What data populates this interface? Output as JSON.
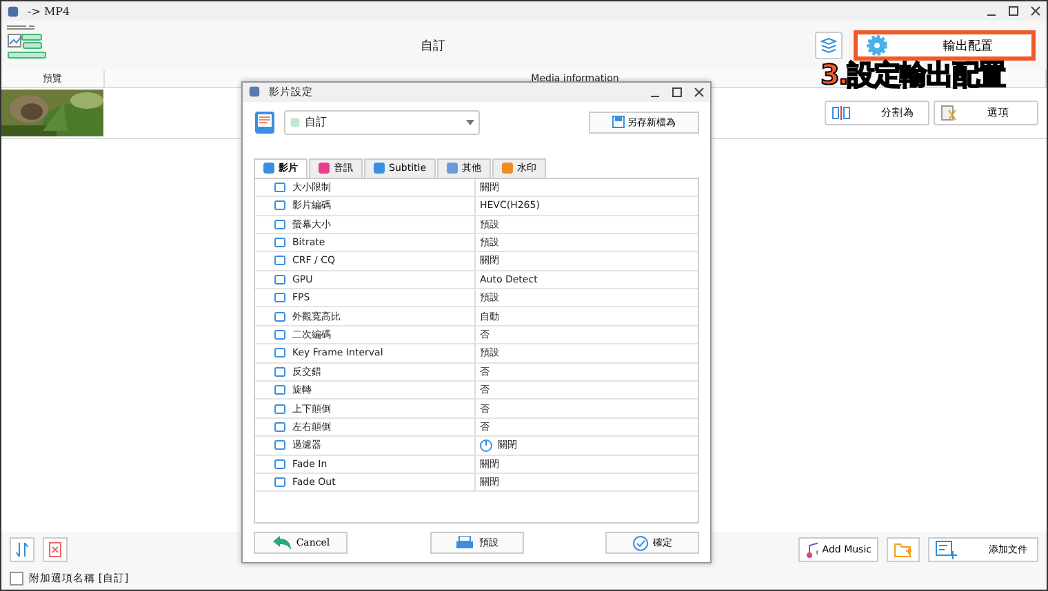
{
  "window": {
    "title": "-> MP4"
  },
  "toolbar": {
    "profile": "自訂",
    "output_button": "輸出配置",
    "annotation": "3.設定輸出配置"
  },
  "table": {
    "columns": [
      "預覽",
      "Media information"
    ],
    "rows": [
      {
        "kind": "picture",
        "split_button": "分割為",
        "options_button": "選項"
      }
    ]
  },
  "bottom": {
    "add_music": "Add Music",
    "add_file": "添加文件",
    "append_name": {
      "label": "附加選項名稱 [自訂]",
      "checked": false
    }
  },
  "dialog": {
    "title": "影片設定",
    "preset": "自訂",
    "save_as": "另存新檔為",
    "tabs": [
      {
        "label": "影片",
        "selected": true,
        "color": "#3b8fe0"
      },
      {
        "label": "音訊",
        "selected": false,
        "color": "#e83e8c"
      },
      {
        "label": "Subtitle",
        "selected": false,
        "color": "#3b8fe0"
      },
      {
        "label": "其他",
        "selected": false,
        "color": "#6a9bd8"
      },
      {
        "label": "水印",
        "selected": false,
        "color": "#f08a24"
      }
    ],
    "rows": [
      {
        "label": "大小限制",
        "value": "關閉",
        "kind": "plain"
      },
      {
        "label": "影片編碼",
        "value": "HEVC(H265)",
        "kind": "plain"
      },
      {
        "label": "螢幕大小",
        "value": "預設",
        "kind": "plain"
      },
      {
        "label": "Bitrate",
        "value": "預設",
        "kind": "plain"
      },
      {
        "label": "CRF / CQ",
        "value": "關閉",
        "kind": "plain"
      },
      {
        "label": "GPU",
        "value": "Auto Detect",
        "kind": "plain"
      },
      {
        "label": "FPS",
        "value": "預設",
        "kind": "plain"
      },
      {
        "label": "外觀寬高比",
        "value": "自動",
        "kind": "plain"
      },
      {
        "label": "二次編碼",
        "value": "否",
        "kind": "plain"
      },
      {
        "label": "Key Frame Interval",
        "value": "預設",
        "kind": "plain"
      },
      {
        "label": "反交錯",
        "value": "否",
        "kind": "plain"
      },
      {
        "label": "旋轉",
        "value": "否",
        "kind": "plain"
      },
      {
        "label": "上下顛倒",
        "value": "否",
        "kind": "plain"
      },
      {
        "label": "左右顛倒",
        "value": "否",
        "kind": "plain"
      },
      {
        "label": "過濾器",
        "value": "關閉",
        "kind": "switch"
      },
      {
        "label": "Fade In",
        "value": "關閉",
        "kind": "plain"
      },
      {
        "label": "Fade Out",
        "value": "關閉",
        "kind": "plain"
      }
    ],
    "buttons": {
      "cancel": "Cancel",
      "default": "預設",
      "ok": "確定"
    }
  }
}
